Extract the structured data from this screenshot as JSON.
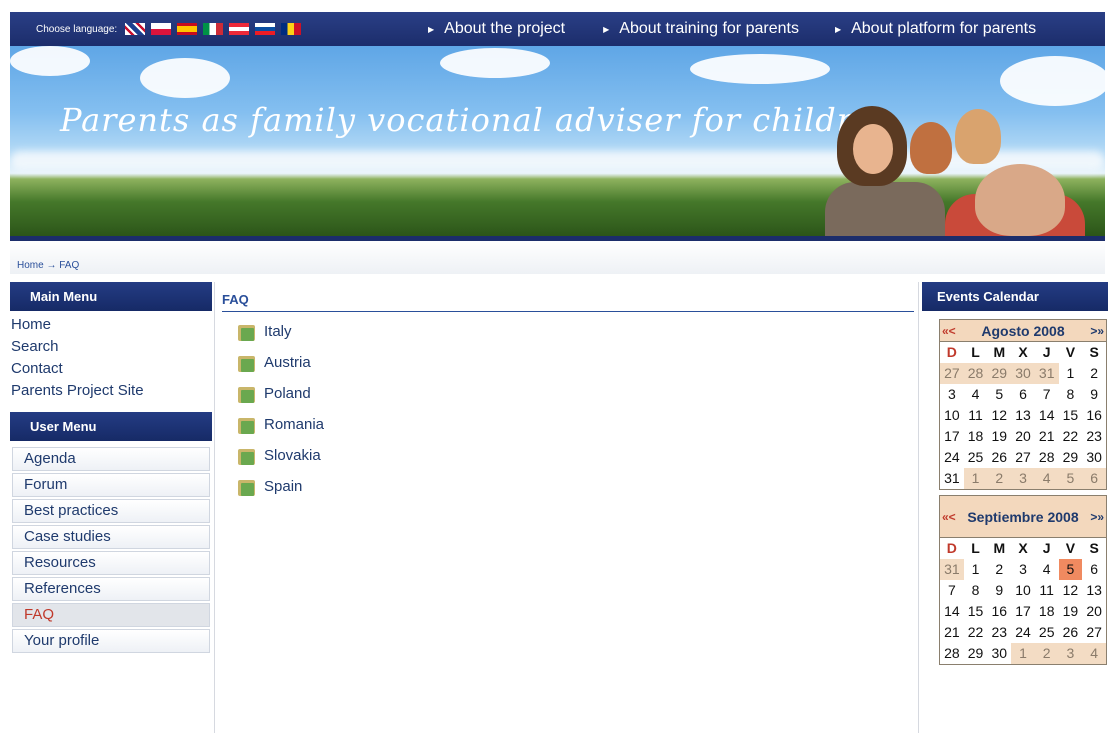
{
  "topbar": {
    "choose_language": "Choose language:",
    "flags": [
      "en",
      "pl",
      "es",
      "it",
      "at",
      "sk",
      "ro"
    ],
    "nav": [
      "About the project",
      "About training for parents",
      "About platform for parents"
    ]
  },
  "banner": {
    "title": "Parents as family vocational adviser for children"
  },
  "breadcrumb": {
    "text": "Home → FAQ"
  },
  "main_menu": {
    "title": "Main Menu",
    "items": [
      "Home",
      "Search",
      "Contact",
      "Parents Project Site"
    ]
  },
  "user_menu": {
    "title": "User Menu",
    "items": [
      "Agenda",
      "Forum",
      "Best practices",
      "Case studies",
      "Resources",
      "References",
      "FAQ",
      "Your profile"
    ],
    "active": "FAQ"
  },
  "page": {
    "title": "FAQ",
    "items": [
      "Italy",
      "Austria",
      "Poland",
      "Romania",
      "Slovakia",
      "Spain"
    ]
  },
  "calendar": {
    "title": "Events Calendar",
    "dow": [
      "D",
      "L",
      "M",
      "X",
      "J",
      "V",
      "S"
    ],
    "prev_label": "«<",
    "next_label": ">»",
    "months": [
      {
        "name": "Agosto 2008",
        "days": [
          [
            "27",
            "o"
          ],
          [
            "28",
            "o"
          ],
          [
            "29",
            "o"
          ],
          [
            "30",
            "o"
          ],
          [
            "31",
            "o"
          ],
          [
            "1",
            ""
          ],
          [
            "2",
            ""
          ],
          [
            "3",
            ""
          ],
          [
            "4",
            ""
          ],
          [
            "5",
            ""
          ],
          [
            "6",
            ""
          ],
          [
            "7",
            ""
          ],
          [
            "8",
            ""
          ],
          [
            "9",
            ""
          ],
          [
            "10",
            ""
          ],
          [
            "11",
            ""
          ],
          [
            "12",
            ""
          ],
          [
            "13",
            ""
          ],
          [
            "14",
            ""
          ],
          [
            "15",
            ""
          ],
          [
            "16",
            ""
          ],
          [
            "17",
            ""
          ],
          [
            "18",
            ""
          ],
          [
            "19",
            ""
          ],
          [
            "20",
            ""
          ],
          [
            "21",
            ""
          ],
          [
            "22",
            ""
          ],
          [
            "23",
            ""
          ],
          [
            "24",
            ""
          ],
          [
            "25",
            ""
          ],
          [
            "26",
            ""
          ],
          [
            "27",
            ""
          ],
          [
            "28",
            ""
          ],
          [
            "29",
            ""
          ],
          [
            "30",
            ""
          ],
          [
            "31",
            ""
          ],
          [
            "1",
            "o"
          ],
          [
            "2",
            "o"
          ],
          [
            "3",
            "o"
          ],
          [
            "4",
            "o"
          ],
          [
            "5",
            "o"
          ],
          [
            "6",
            "o"
          ]
        ]
      },
      {
        "name": "Septiembre 2008",
        "days": [
          [
            "31",
            "o"
          ],
          [
            "1",
            ""
          ],
          [
            "2",
            ""
          ],
          [
            "3",
            ""
          ],
          [
            "4",
            ""
          ],
          [
            "5",
            "t"
          ],
          [
            "6",
            ""
          ],
          [
            "7",
            ""
          ],
          [
            "8",
            ""
          ],
          [
            "9",
            ""
          ],
          [
            "10",
            ""
          ],
          [
            "11",
            ""
          ],
          [
            "12",
            ""
          ],
          [
            "13",
            ""
          ],
          [
            "14",
            ""
          ],
          [
            "15",
            ""
          ],
          [
            "16",
            ""
          ],
          [
            "17",
            ""
          ],
          [
            "18",
            ""
          ],
          [
            "19",
            ""
          ],
          [
            "20",
            ""
          ],
          [
            "21",
            ""
          ],
          [
            "22",
            ""
          ],
          [
            "23",
            ""
          ],
          [
            "24",
            ""
          ],
          [
            "25",
            ""
          ],
          [
            "26",
            ""
          ],
          [
            "27",
            ""
          ],
          [
            "28",
            ""
          ],
          [
            "29",
            ""
          ],
          [
            "30",
            ""
          ],
          [
            "1",
            "o"
          ],
          [
            "2",
            "o"
          ],
          [
            "3",
            "o"
          ],
          [
            "4",
            "o"
          ]
        ]
      }
    ]
  },
  "colors": {
    "navy": "#1c2d6b",
    "link": "#1f3a6d",
    "active": "#c0392b",
    "cal_other": "#f3dcc4",
    "cal_today": "#f08a60"
  }
}
